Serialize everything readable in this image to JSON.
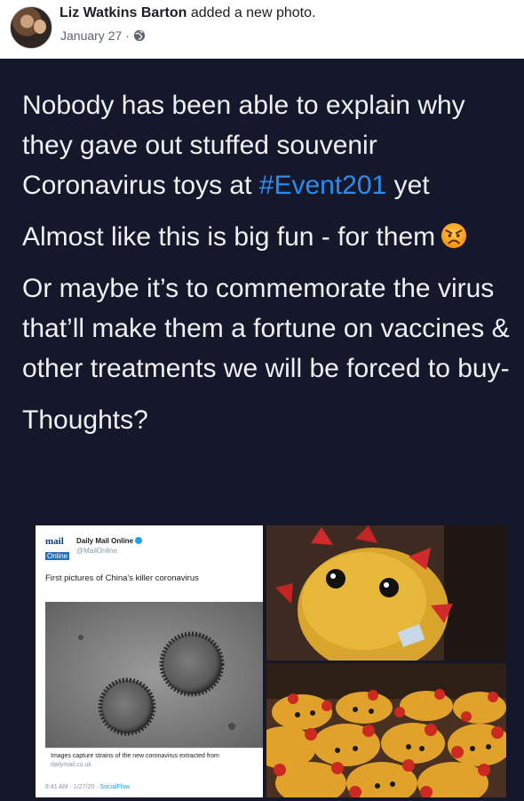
{
  "post": {
    "author": "Liz Watkins Barton",
    "action": "added a new photo.",
    "date": "January 27",
    "separator": "·",
    "privacy_icon": "globe-icon"
  },
  "text": {
    "line1": "Nobody has been able to explain why they gave out stuffed souvenir Coronavirus toys at ",
    "hashtag": "#Event201",
    "line1_end": " yet",
    "line2": "Almost like this is big fun - for them",
    "emoji": "angry-face-icon",
    "line3": "Or maybe it’s to commemorate the virus that’ll make them a fortune on vaccines & other treatments we will be forced to buy-",
    "line4": "Thoughts?"
  },
  "tweet": {
    "logo_top": "mail",
    "logo_bottom": "Online",
    "name": "Daily Mail Online",
    "handle": "@MailOnline",
    "text": "First pictures of China's killer coronavirus",
    "link_title": "Images capture strains of the new coronavirus extracted from",
    "link_domain": "dailymail.co.uk",
    "timestamp": "8:41 AM · 1/27/20 · ",
    "source": "SocialFlow"
  },
  "colors": {
    "post_background": "#14182a",
    "hashtag": "#2a8cf0",
    "text": "#eef0f4"
  }
}
